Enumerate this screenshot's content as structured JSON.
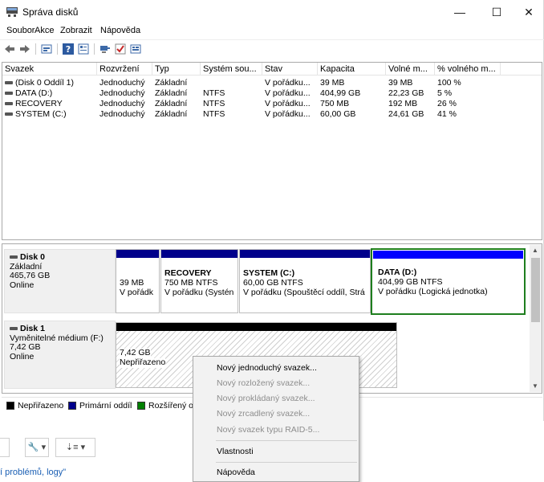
{
  "window": {
    "title": "Správa disků",
    "controls": {
      "minimize": "—",
      "maximize": "☐",
      "close": "✕"
    }
  },
  "menu": [
    "Soubor",
    "Akce",
    "Zobrazit",
    "Nápověda"
  ],
  "toolbar_icons": [
    "back-arrow-icon",
    "forward-arrow-icon",
    "disk-list-icon",
    "help-icon",
    "properties-icon",
    "connect-icon",
    "check-icon",
    "view-icon"
  ],
  "volume_list": {
    "headers": [
      "Svazek",
      "Rozvržení",
      "Typ",
      "Systém sou...",
      "Stav",
      "Kapacita",
      "Volné m...",
      "% volného m..."
    ],
    "rows": [
      [
        "(Disk 0 Oddíl 1)",
        "Jednoduchý",
        "Základní",
        "",
        "V pořádku...",
        "39 MB",
        "39 MB",
        "100 %"
      ],
      [
        "DATA (D:)",
        "Jednoduchý",
        "Základní",
        "NTFS",
        "V pořádku...",
        "404,99 GB",
        "22,23 GB",
        "5 %"
      ],
      [
        "RECOVERY",
        "Jednoduchý",
        "Základní",
        "NTFS",
        "V pořádku...",
        "750 MB",
        "192 MB",
        "26 %"
      ],
      [
        "SYSTEM (C:)",
        "Jednoduchý",
        "Základní",
        "NTFS",
        "V pořádku...",
        "60,00 GB",
        "24,61 GB",
        "41 %"
      ]
    ]
  },
  "disks": {
    "disk0": {
      "name": "Disk 0",
      "type": "Základní",
      "size": "465,76 GB",
      "status": "Online",
      "partitions": {
        "p1": {
          "title": "",
          "size": "39 MB",
          "status": "V pořádk"
        },
        "recovery": {
          "title": "RECOVERY",
          "size": "750 MB NTFS",
          "status": "V pořádku (Systén"
        },
        "system": {
          "title": "SYSTEM  (C:)",
          "size": "60,00 GB NTFS",
          "status": "V pořádku (Spouštěcí oddíl, Strá"
        },
        "data": {
          "title": "DATA  (D:)",
          "size": "404,99 GB NTFS",
          "status": "V pořádku (Logická jednotka)"
        }
      }
    },
    "disk1": {
      "name": "Disk 1",
      "type": "Vyměnitelné médium (F:)",
      "size": "7,42 GB",
      "status": "Online",
      "partition": {
        "size": "7,42 GB",
        "status": "Nepřiřazeno"
      }
    }
  },
  "legend": [
    {
      "label": "Nepřiřazeno",
      "color": "#000000"
    },
    {
      "label": "Primární oddíl",
      "color": "#00008b"
    },
    {
      "label": "Rozšířený o",
      "color": "#008000"
    }
  ],
  "context_menu": {
    "items": [
      {
        "label": "Nový jednoduchý svazek...",
        "enabled": true
      },
      {
        "label": "Nový rozložený svazek...",
        "enabled": false
      },
      {
        "label": "Nový prokládaný svazek...",
        "enabled": false
      },
      {
        "label": "Nový zrcadlený svazek...",
        "enabled": false
      },
      {
        "label": "Nový svazek typu RAID-5...",
        "enabled": false
      },
      {
        "label": "Vlastnosti",
        "enabled": true
      },
      {
        "label": "Nápověda",
        "enabled": true
      }
    ]
  },
  "background": {
    "link_text": "í problémů, logy\""
  },
  "colors": {
    "primary_partition": "#00008b",
    "logical_drive": "#0000ff",
    "unallocated": "#000000",
    "selected_border": "#1e7e1e"
  }
}
